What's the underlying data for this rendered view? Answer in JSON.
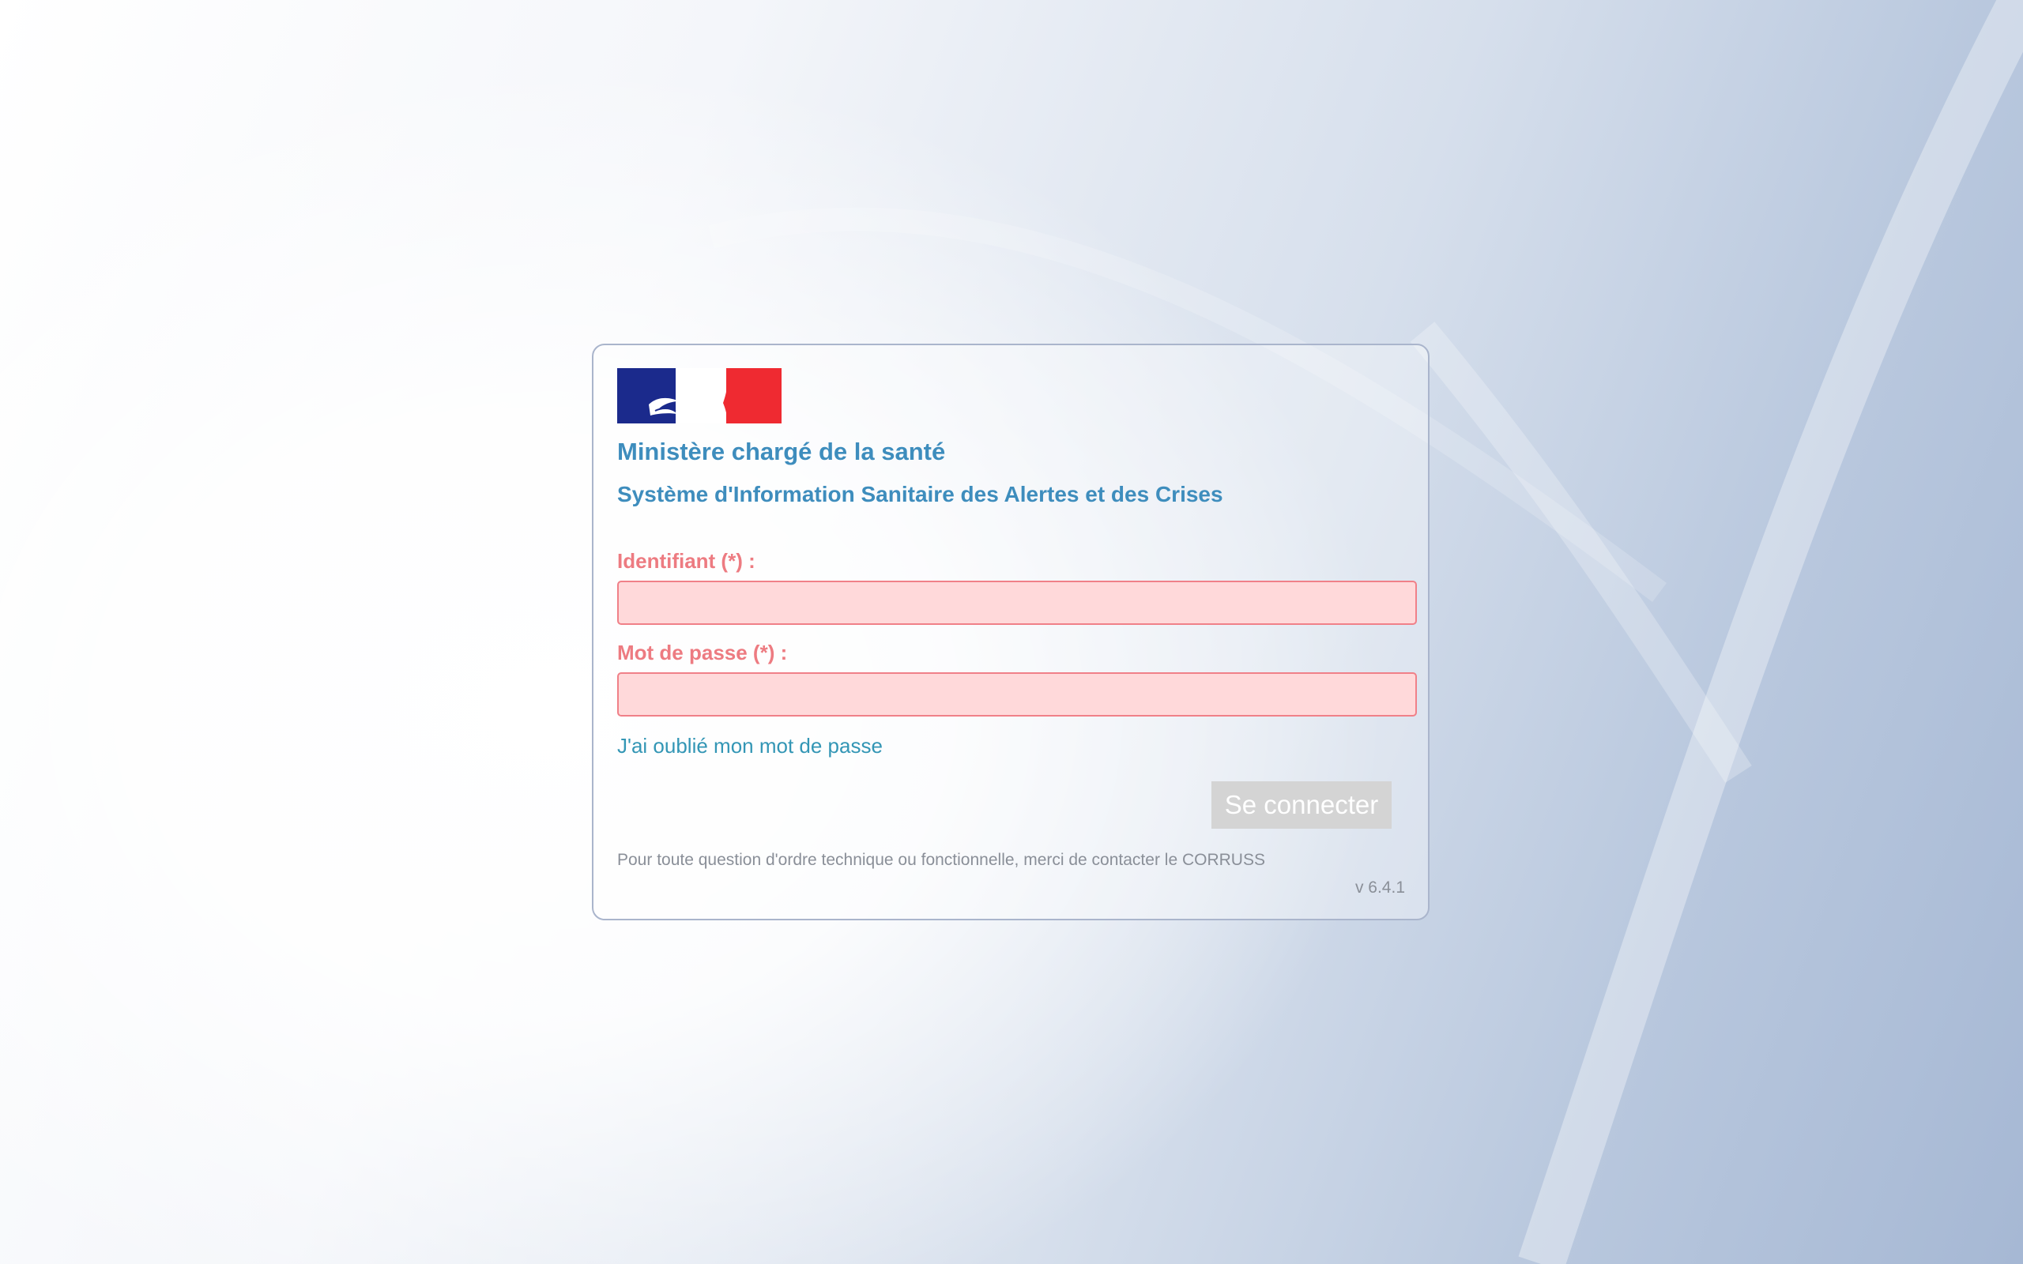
{
  "header": {
    "logo": "marianne-logo",
    "ministry_title": "Ministère chargé de la santé",
    "system_title": "Système d'Information Sanitaire des Alertes et des Crises"
  },
  "form": {
    "username_label": "Identifiant (*) :",
    "username_value": "",
    "password_label": "Mot de passe (*) :",
    "password_value": "",
    "forgot_password_link": "J'ai oublié mon mot de passe",
    "submit_label": "Se connecter"
  },
  "footer": {
    "contact_text": "Pour toute question d'ordre technique ou fonctionnelle, merci de contacter le CORRUSS",
    "version": "v 6.4.1"
  },
  "colors": {
    "heading": "#3e8dbd",
    "label_error": "#ed7b81",
    "field_error_bg": "#ffd9da",
    "field_error_border": "#f08088",
    "link": "#3396b5",
    "button_disabled_bg": "#d4d4d4",
    "flag_blue": "#1b2a8c",
    "flag_red": "#ef2a31"
  }
}
